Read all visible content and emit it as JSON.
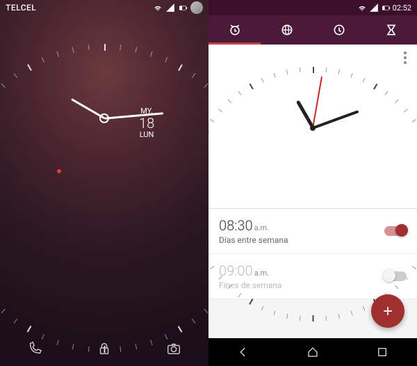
{
  "left": {
    "carrier": "TELCEL",
    "date": {
      "month": "MY.",
      "day": "18",
      "dow": "LUN"
    },
    "clock": {
      "hour_angle": 300,
      "minute_angle": 85
    }
  },
  "right": {
    "status_time": "02:52",
    "tabs": [
      "alarm",
      "world",
      "clock",
      "timer"
    ],
    "active_tab_index": 0,
    "clock": {
      "hour_angle": 330,
      "minute_angle": 70,
      "second_angle": 10
    },
    "alarms": [
      {
        "time": "08:30",
        "ampm": "a.m.",
        "label": "Días entre semana",
        "enabled": true
      },
      {
        "time": "09:00",
        "ampm": "a.m.",
        "label": "Fines de semana",
        "enabled": false
      }
    ]
  }
}
